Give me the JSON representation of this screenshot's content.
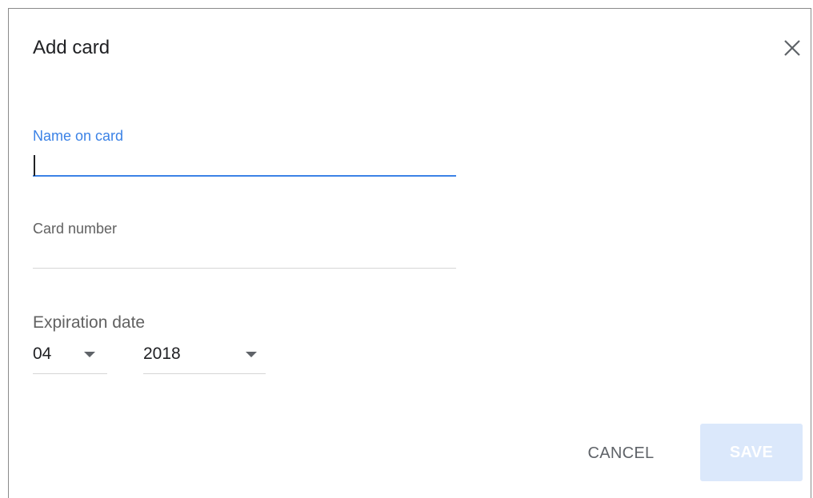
{
  "dialog": {
    "title": "Add card",
    "close_icon": "close-icon"
  },
  "fields": {
    "name_on_card": {
      "label": "Name on card",
      "value": "",
      "focused": true
    },
    "card_number": {
      "label": "Card number",
      "value": ""
    }
  },
  "expiration": {
    "label": "Expiration date",
    "month": "04",
    "year": "2018"
  },
  "actions": {
    "cancel_label": "CANCEL",
    "save_label": "SAVE",
    "save_enabled": false
  },
  "colors": {
    "accent": "#3b82e6",
    "save_disabled_bg": "#dbe8fb"
  }
}
